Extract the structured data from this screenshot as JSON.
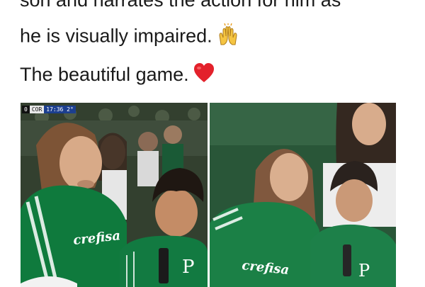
{
  "caption": {
    "line1": "son and narrates the action for him as",
    "line2": "he is visually impaired.",
    "line3": "The beautiful game."
  },
  "emoji": {
    "line2": "raised-hands-icon",
    "line3": "red-heart-icon"
  },
  "left_photo": {
    "scorebug": {
      "score": "0",
      "team": "COR",
      "time": "17:36 2°"
    },
    "shirt_sponsor": "crefisa",
    "shirt_crest": "P"
  },
  "right_photo": {
    "shirt_sponsor": "crefisa",
    "shirt_crest": "P"
  },
  "colors": {
    "palmeiras_green": "#0f7a3d",
    "heart_red": "#e3212b"
  }
}
